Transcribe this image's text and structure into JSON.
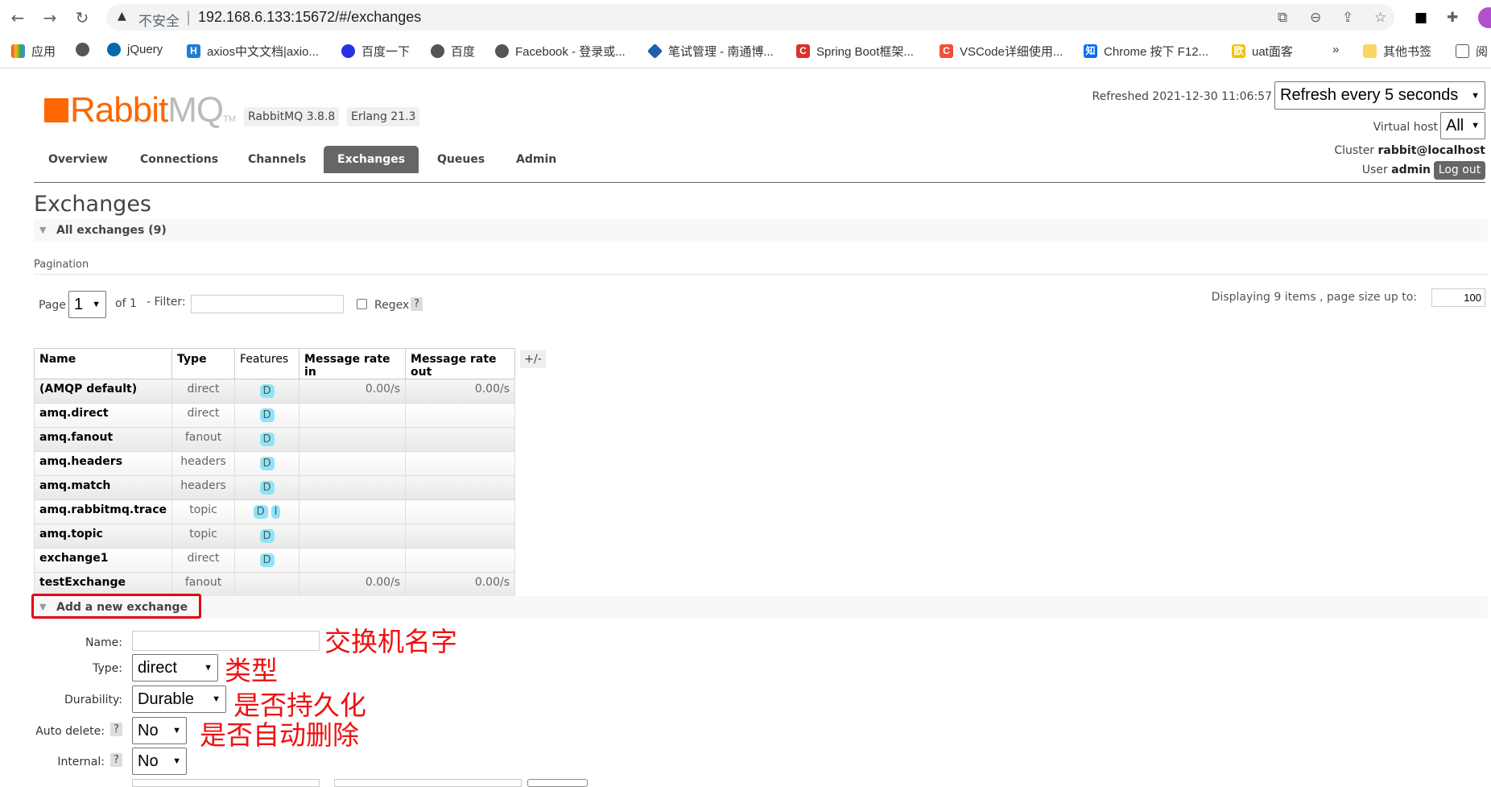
{
  "browser": {
    "insecure_label": "不安全",
    "url": "192.168.6.133:15672/#/exchanges",
    "bookmarks": [
      {
        "label": "应用",
        "icon": "apps-grid-icon"
      },
      {
        "label": "",
        "icon": "globe-icon"
      },
      {
        "label": "jQuery",
        "icon": "jquery-icon"
      },
      {
        "label": "axios中文文档|axio...",
        "icon": "axios-icon"
      },
      {
        "label": "百度一下",
        "icon": "baidu-icon"
      },
      {
        "label": "百度",
        "icon": "globe-icon"
      },
      {
        "label": "Facebook - 登录或...",
        "icon": "globe-icon"
      },
      {
        "label": "笔试管理 - 南通博...",
        "icon": "diamond-icon"
      },
      {
        "label": "Spring Boot框架...",
        "icon": "csdn-icon"
      },
      {
        "label": "VSCode详细使用...",
        "icon": "csdn-icon"
      },
      {
        "label": "Chrome 按下 F12...",
        "icon": "zhihu-icon"
      },
      {
        "label": "uat面客",
        "icon": "ou-icon"
      }
    ],
    "more": "»",
    "other_bookmarks": "其他书签",
    "reading_list": "阅"
  },
  "header": {
    "logo_main": "Rabbit",
    "logo_mq": "MQ",
    "logo_tm": "TM",
    "version": "RabbitMQ 3.8.8",
    "erlang": "Erlang 21.3",
    "refreshed": "Refreshed 2021-12-30 11:06:57",
    "refresh_select": "Refresh every 5 seconds",
    "vhost_label": "Virtual host",
    "vhost_value": "All",
    "cluster_label": "Cluster",
    "cluster_value": "rabbit@localhost",
    "user_label": "User",
    "user_value": "admin",
    "logout": "Log out"
  },
  "nav": {
    "tabs": [
      "Overview",
      "Connections",
      "Channels",
      "Exchanges",
      "Queues",
      "Admin"
    ],
    "active": "Exchanges"
  },
  "page": {
    "title": "Exchanges",
    "all_section": "All exchanges (9)",
    "pagination_label": "Pagination",
    "page_label": "Page",
    "page_value": "1",
    "of_label": "of 1",
    "filter_label": "- Filter:",
    "filter_value": "",
    "regex_label": "Regex",
    "help": "?",
    "displaying": "Displaying 9 items , page size up to:",
    "page_size": "100"
  },
  "table": {
    "columns": [
      "Name",
      "Type",
      "Features",
      "Message rate in",
      "Message rate out"
    ],
    "toggle": "+/-",
    "rows": [
      {
        "name": "(AMQP default)",
        "type": "direct",
        "features": [
          "D"
        ],
        "rate_in": "0.00/s",
        "rate_out": "0.00/s"
      },
      {
        "name": "amq.direct",
        "type": "direct",
        "features": [
          "D"
        ],
        "rate_in": "",
        "rate_out": ""
      },
      {
        "name": "amq.fanout",
        "type": "fanout",
        "features": [
          "D"
        ],
        "rate_in": "",
        "rate_out": ""
      },
      {
        "name": "amq.headers",
        "type": "headers",
        "features": [
          "D"
        ],
        "rate_in": "",
        "rate_out": ""
      },
      {
        "name": "amq.match",
        "type": "headers",
        "features": [
          "D"
        ],
        "rate_in": "",
        "rate_out": ""
      },
      {
        "name": "amq.rabbitmq.trace",
        "type": "topic",
        "features": [
          "D",
          "I"
        ],
        "rate_in": "",
        "rate_out": ""
      },
      {
        "name": "amq.topic",
        "type": "topic",
        "features": [
          "D"
        ],
        "rate_in": "",
        "rate_out": ""
      },
      {
        "name": "exchange1",
        "type": "direct",
        "features": [
          "D"
        ],
        "rate_in": "",
        "rate_out": ""
      },
      {
        "name": "testExchange",
        "type": "fanout",
        "features": [],
        "rate_in": "0.00/s",
        "rate_out": "0.00/s"
      }
    ]
  },
  "add_form": {
    "section": "Add a new exchange",
    "name_label": "Name:",
    "name_value": "",
    "type_label": "Type:",
    "type_value": "direct",
    "durability_label": "Durability:",
    "durability_value": "Durable",
    "autodelete_label": "Auto delete:",
    "autodelete_value": "No",
    "internal_label": "Internal:",
    "internal_value": "No"
  },
  "annotations": {
    "name": "交换机名字",
    "type": "类型",
    "durability": "是否持久化",
    "autodelete": "是否自动删除",
    "color": "#f01010"
  },
  "colors": {
    "brand": "#ff6600",
    "active_tab": "#666666",
    "feature_badge": "#8ee4f8",
    "highlight_box": "#e60012"
  }
}
